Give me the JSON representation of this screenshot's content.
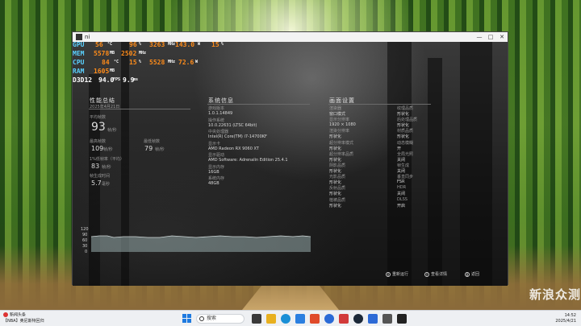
{
  "window": {
    "title": "ni",
    "controls": [
      "—",
      "□",
      "✕"
    ]
  },
  "osd": {
    "rows": [
      {
        "label": "GPU",
        "v1": "56",
        "u1": "°C",
        "v2": "96",
        "u2": "%",
        "v3": "3263",
        "u3": "MHz",
        "v4": "143.0",
        "u4": "W",
        "v5": "15",
        "u5": "%"
      },
      {
        "label": "MEM",
        "v1": "5578",
        "u1": "MB",
        "v2": "2502",
        "u2": "MHz"
      },
      {
        "label": "CPU",
        "v1": "84",
        "u1": "°C",
        "v2": "15",
        "u2": "%",
        "v3": "5528",
        "u3": "MHz",
        "v4": "72.6",
        "u4": "W"
      },
      {
        "label": "RAM",
        "v1": "1605",
        "u1": "MB"
      },
      {
        "label": "D3D12",
        "v1": "94.0",
        "u1": "FPS",
        "v2": "9.9",
        "u2": "ms"
      }
    ]
  },
  "performance": {
    "title": "性能总结",
    "subtitle": "2025年4月21日",
    "avg_fps_label": "平均帧数",
    "avg_fps": "93",
    "avg_fps_unit": "帧/秒",
    "max_fps_label": "最高帧数",
    "max_fps": "109",
    "max_fps_unit": "帧/秒",
    "min_fps_label": "最低帧数",
    "min_fps": "79",
    "min_fps_unit": "帧/秒",
    "low1_label": "1%低帧率（平均）",
    "low1": "83",
    "low1_unit": "帧/秒",
    "frametime_label": "帧生成时间",
    "frametime": "5.7",
    "frametime_unit": "毫秒"
  },
  "graph": {
    "y_ticks": [
      "120",
      "90",
      "60",
      "30",
      "0"
    ]
  },
  "sysinfo": {
    "title": "系统信息",
    "items": [
      {
        "label": "游戏版本",
        "value": "1.0.1.14849"
      },
      {
        "label": "操作系统",
        "value": "10.0.22631 (LTSC 64bit)"
      },
      {
        "label": "中央处理器",
        "value": "Intel(R) Core(TM) i7-14700KF"
      },
      {
        "label": "显示卡",
        "value": "AMD Radeon RX 9060 XT"
      },
      {
        "label": "显示驱动",
        "value": "AMD Software: Adrenalin Edition 25.4.1"
      },
      {
        "label": "显示内存",
        "value": "16GB"
      },
      {
        "label": "系统内存",
        "value": "48GB"
      }
    ]
  },
  "graphics": {
    "title": "画面设置",
    "left": [
      {
        "label": "渲染器",
        "value": "窗口模式"
      },
      {
        "label": "显示分辨率",
        "value": "1920 × 1080"
      },
      {
        "label": "渲染分辨率",
        "value": "形状化"
      },
      {
        "label": "超分辨率模式",
        "value": "形状化"
      },
      {
        "label": "超分辨率品质",
        "value": "形状化"
      },
      {
        "label": "阴影品质",
        "value": "形状化"
      },
      {
        "label": "光影品质",
        "value": "形状化"
      },
      {
        "label": "反射品质",
        "value": "形状化"
      },
      {
        "label": "植被品质",
        "value": "形状化"
      }
    ],
    "right": [
      {
        "label": "纹理品质",
        "value": "形状化"
      },
      {
        "label": "后处理品质",
        "value": "形状化"
      },
      {
        "label": "材质品质",
        "value": "形状化"
      },
      {
        "label": "动态模糊",
        "value": "开"
      },
      {
        "label": "全局光照",
        "value": "关闭"
      },
      {
        "label": "帧生成",
        "value": "关闭"
      },
      {
        "label": "垂直同步",
        "value": "FSR"
      },
      {
        "label": "HDR",
        "value": "关闭"
      },
      {
        "label": "DLSS",
        "value": "开启"
      }
    ]
  },
  "bottom_buttons": [
    {
      "key": "X",
      "label": "重新运行"
    },
    {
      "key": "Y",
      "label": "查看详情"
    },
    {
      "key": "B",
      "label": "返回"
    }
  ],
  "watermark": "新浪众测",
  "taskbar": {
    "notify_title": "新闻头条",
    "notify_sub": "【NBA】奥尼斯特回归",
    "search_placeholder": "搜索",
    "time": "14:52",
    "date": "2025/4/21",
    "colors": {
      "start": "#1e7ae0"
    }
  }
}
